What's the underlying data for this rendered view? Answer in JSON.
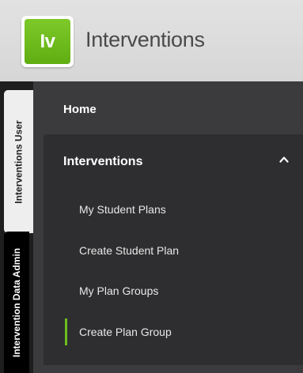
{
  "header": {
    "logo_text": "Iv",
    "app_title": "Interventions",
    "logo_color": "#6bbb1c"
  },
  "rail": {
    "tabs": [
      {
        "label": "Interventions User",
        "active": true
      },
      {
        "label": "Intervention Data Admin",
        "active": false
      }
    ]
  },
  "nav": {
    "home_label": "Home",
    "section": {
      "label": "Interventions",
      "expanded": true,
      "chevron_icon": "chevron-up-icon",
      "items": [
        {
          "label": "My Student Plans",
          "active": false
        },
        {
          "label": "Create Student Plan",
          "active": false
        },
        {
          "label": "My Plan Groups",
          "active": false
        },
        {
          "label": "Create Plan Group",
          "active": true
        }
      ]
    },
    "active_indicator_color": "#6cbf1e"
  }
}
